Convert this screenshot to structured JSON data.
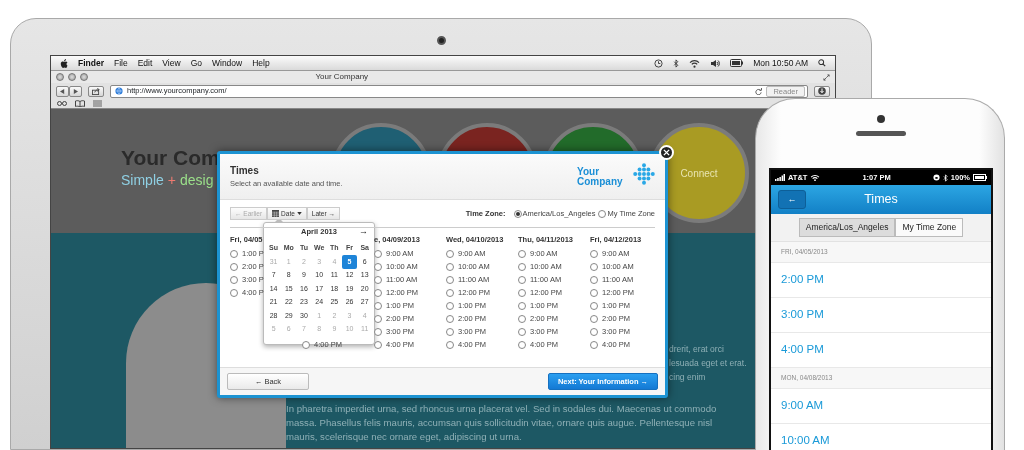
{
  "menubar": {
    "app": "Finder",
    "menus": [
      "File",
      "Edit",
      "View",
      "Go",
      "Window",
      "Help"
    ],
    "clock": "Mon 10:50 AM"
  },
  "browser": {
    "title": "Your Company",
    "url": "http://www.yourcompany.com/",
    "reader": {
      "label": "Reader",
      "disabled": true
    }
  },
  "website": {
    "title": "Your Com",
    "tagline": [
      {
        "text": "Simple",
        "color": "#8fd0e4"
      },
      {
        "text": "+",
        "color": "#f07a70"
      },
      {
        "text": "desig",
        "color": "#9be08a"
      }
    ],
    "circles": [
      {
        "color": "#1f5f73"
      },
      {
        "color": "#7a2420"
      },
      {
        "color": "#226b2a"
      },
      {
        "color": "#a99b23",
        "label": "Connect"
      }
    ],
    "partial_lines": [
      "drerit, erat orci",
      "lesuada eget et erat.",
      "cing enim"
    ],
    "paragraph": "In pharetra imperdiet urna, sed rhoncus urna placerat vel. Sed in sodales dui. Maecenas ut commodo massa. Phasellus felis mauris, accumsan quis sollicitudin vitae, ornare quis augue. Pellentesque nisl mauris, scelerisque nec ornare eget, adipiscing ut urna."
  },
  "modal": {
    "title": "Times",
    "subtitle": "Select an available date and time.",
    "logo": "Your Company",
    "date_nav": [
      {
        "kind": "button",
        "label": "← Earlier",
        "disabled": true
      },
      {
        "kind": "dropdown",
        "label": "Date",
        "disabled": false
      },
      {
        "kind": "button",
        "label": "Later →",
        "disabled": false
      }
    ],
    "time_zone": {
      "label": "Time Zone:",
      "options": [
        {
          "label": "America/Los_Angeles",
          "selected": true
        },
        {
          "label": "My Time Zone",
          "selected": false
        }
      ]
    },
    "days": [
      {
        "header": "Fri, 04/05",
        "times": [
          {
            "label": "1:00 P",
            "selected": false
          },
          {
            "label": "2:00 P",
            "selected": false
          },
          {
            "label": "3:00 P",
            "selected": false
          },
          {
            "label": "4:00 P",
            "selected": false
          }
        ]
      },
      {
        "times": [
          {
            "label": "4:00 PM",
            "selected": false
          }
        ]
      },
      {
        "header": "e, 04/09/2013",
        "times": [
          {
            "label": "9:00 AM",
            "selected": false
          },
          {
            "label": "10:00 AM",
            "selected": false
          },
          {
            "label": "11:00 AM",
            "selected": false
          },
          {
            "label": "12:00 PM",
            "selected": false
          },
          {
            "label": "1:00 PM",
            "selected": false
          },
          {
            "label": "2:00 PM",
            "selected": false
          },
          {
            "label": "3:00 PM",
            "selected": false
          },
          {
            "label": "4:00 PM",
            "selected": false
          }
        ]
      },
      {
        "header": "Wed, 04/10/2013",
        "times": [
          {
            "label": "9:00 AM",
            "selected": false
          },
          {
            "label": "10:00 AM",
            "selected": false
          },
          {
            "label": "11:00 AM",
            "selected": false
          },
          {
            "label": "12:00 PM",
            "selected": false
          },
          {
            "label": "1:00 PM",
            "selected": false
          },
          {
            "label": "2:00 PM",
            "selected": false
          },
          {
            "label": "3:00 PM",
            "selected": false
          },
          {
            "label": "4:00 PM",
            "selected": false
          }
        ]
      },
      {
        "header": "Thu, 04/11/2013",
        "times": [
          {
            "label": "9:00 AM",
            "selected": false
          },
          {
            "label": "10:00 AM",
            "selected": false
          },
          {
            "label": "11:00 AM",
            "selected": false
          },
          {
            "label": "12:00 PM",
            "selected": false
          },
          {
            "label": "1:00 PM",
            "selected": false
          },
          {
            "label": "2:00 PM",
            "selected": false
          },
          {
            "label": "3:00 PM",
            "selected": false
          },
          {
            "label": "4:00 PM",
            "selected": false
          }
        ]
      },
      {
        "header": "Fri, 04/12/2013",
        "times": [
          {
            "label": "9:00 AM",
            "selected": false
          },
          {
            "label": "10:00 AM",
            "selected": false
          },
          {
            "label": "11:00 AM",
            "selected": false
          },
          {
            "label": "12:00 PM",
            "selected": false
          },
          {
            "label": "1:00 PM",
            "selected": false
          },
          {
            "label": "2:00 PM",
            "selected": false
          },
          {
            "label": "3:00 PM",
            "selected": false
          },
          {
            "label": "4:00 PM",
            "selected": false
          }
        ]
      }
    ],
    "calendar": {
      "month": "April 2013",
      "next": "→",
      "weekdays": [
        "Su",
        "Mo",
        "Tu",
        "We",
        "Th",
        "Fr",
        "Sa"
      ],
      "weeks": [
        [
          {
            "day": "31",
            "muted": true,
            "selected": false
          },
          {
            "day": "1",
            "muted": true,
            "selected": false
          },
          {
            "day": "2",
            "muted": true,
            "selected": false
          },
          {
            "day": "3",
            "muted": true,
            "selected": false
          },
          {
            "day": "4",
            "muted": true,
            "selected": false
          },
          {
            "day": "5",
            "muted": false,
            "selected": true
          },
          {
            "day": "6",
            "muted": false,
            "selected": false
          }
        ],
        [
          {
            "day": "7",
            "muted": false,
            "selected": false
          },
          {
            "day": "8",
            "muted": false,
            "selected": false
          },
          {
            "day": "9",
            "muted": false,
            "selected": false
          },
          {
            "day": "10",
            "muted": false,
            "selected": false
          },
          {
            "day": "11",
            "muted": false,
            "selected": false
          },
          {
            "day": "12",
            "muted": false,
            "selected": false
          },
          {
            "day": "13",
            "muted": false,
            "selected": false
          }
        ],
        [
          {
            "day": "14",
            "muted": false,
            "selected": false
          },
          {
            "day": "15",
            "muted": false,
            "selected": false
          },
          {
            "day": "16",
            "muted": false,
            "selected": false
          },
          {
            "day": "17",
            "muted": false,
            "selected": false
          },
          {
            "day": "18",
            "muted": false,
            "selected": false
          },
          {
            "day": "19",
            "muted": false,
            "selected": false
          },
          {
            "day": "20",
            "muted": false,
            "selected": false
          }
        ],
        [
          {
            "day": "21",
            "muted": false,
            "selected": false
          },
          {
            "day": "22",
            "muted": false,
            "selected": false
          },
          {
            "day": "23",
            "muted": false,
            "selected": false
          },
          {
            "day": "24",
            "muted": false,
            "selected": false
          },
          {
            "day": "25",
            "muted": false,
            "selected": false
          },
          {
            "day": "26",
            "muted": false,
            "selected": false
          },
          {
            "day": "27",
            "muted": false,
            "selected": false
          }
        ],
        [
          {
            "day": "28",
            "muted": false,
            "selected": false
          },
          {
            "day": "29",
            "muted": false,
            "selected": false
          },
          {
            "day": "30",
            "muted": false,
            "selected": false
          },
          {
            "day": "1",
            "muted": true,
            "selected": false
          },
          {
            "day": "2",
            "muted": true,
            "selected": false
          },
          {
            "day": "3",
            "muted": true,
            "selected": false
          },
          {
            "day": "4",
            "muted": true,
            "selected": false
          }
        ],
        [
          {
            "day": "5",
            "muted": true,
            "selected": false
          },
          {
            "day": "6",
            "muted": true,
            "selected": false
          },
          {
            "day": "7",
            "muted": true,
            "selected": false
          },
          {
            "day": "8",
            "muted": true,
            "selected": false
          },
          {
            "day": "9",
            "muted": true,
            "selected": false
          },
          {
            "day": "10",
            "muted": true,
            "selected": false
          },
          {
            "day": "11",
            "muted": true,
            "selected": false
          }
        ]
      ]
    },
    "back": "← Back",
    "next": "Next: Your Information →"
  },
  "phone": {
    "carrier": "AT&T",
    "time": "1:07 PM",
    "battery": "100%",
    "back": "←",
    "title": "Times",
    "segments": [
      {
        "label": "America/Los_Angeles",
        "selected": true
      },
      {
        "label": "My Time Zone",
        "selected": false
      }
    ],
    "list": [
      {
        "kind": "section",
        "label": "FRI, 04/05/2013"
      },
      {
        "kind": "time",
        "label": "2:00 PM"
      },
      {
        "kind": "time",
        "label": "3:00 PM"
      },
      {
        "kind": "time",
        "label": "4:00 PM"
      },
      {
        "kind": "section",
        "label": "MON, 04/08/2013"
      },
      {
        "kind": "time",
        "label": "9:00 AM"
      },
      {
        "kind": "time",
        "label": "10:00 AM"
      }
    ]
  }
}
